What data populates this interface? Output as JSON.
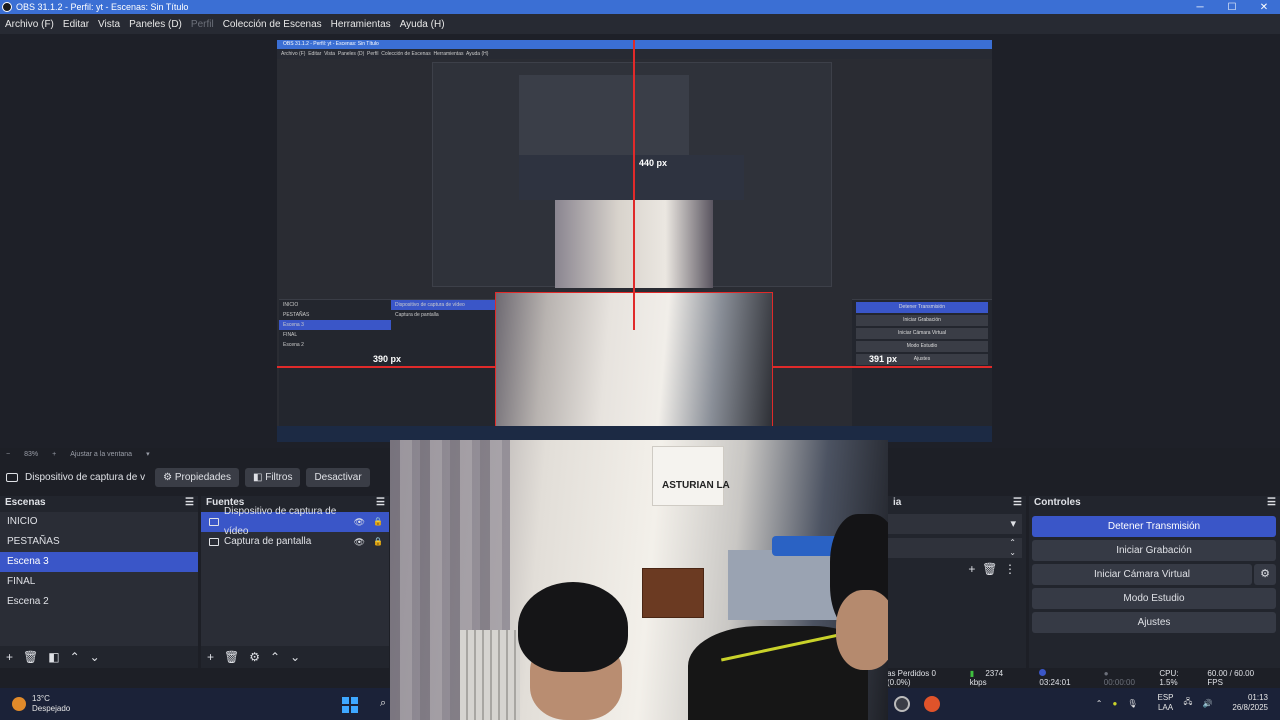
{
  "window": {
    "title": "OBS 31.1.2 - Perfil: yt - Escenas: Sin Título",
    "min": "─",
    "max": "☐",
    "close": "✕"
  },
  "menu": [
    "Archivo (F)",
    "Editar",
    "Vista",
    "Paneles (D)",
    "Perfil",
    "Colección de Escenas",
    "Herramientas",
    "Ayuda (H)"
  ],
  "preview": {
    "inner_title": "OBS 31.1.2 - Perfil: yt - Escenas: Sin Título",
    "px_top": "440 px",
    "px_left": "390 px",
    "px_right": "391 px",
    "mini_scenes": [
      "INICIO",
      "PESTAÑAS",
      "Escena 3",
      "FINAL",
      "Escena 2"
    ],
    "mini_sources": [
      "Dispositivo de captura de vídeo",
      "Captura de pantalla"
    ],
    "mini_controls": [
      "Detener Transmisión",
      "Iniciar Grabación",
      "Iniciar Cámara Virtual",
      "Modo Estudio",
      "Ajustes"
    ],
    "shirt_text": "ASTURIAN LA"
  },
  "zoombar": {
    "minus": "−",
    "zoom": "83%",
    "plus": "+",
    "fit": "Ajustar a la ventana",
    "dropdown": "▾"
  },
  "source_toolbar": {
    "name": "Dispositivo de captura de v",
    "properties": "Propiedades",
    "filters": "Filtros",
    "deactivate": "Desactivar"
  },
  "scenes": {
    "title": "Escenas",
    "items": [
      "INICIO",
      "PESTAÑAS",
      "Escena 3",
      "FINAL",
      "Escena 2"
    ],
    "selected": 2
  },
  "sources": {
    "title": "Fuentes",
    "items": [
      {
        "label": "Dispositivo de captura de vídeo",
        "selected": true
      },
      {
        "label": "Captura de pantalla",
        "selected": false
      }
    ]
  },
  "mixer": {
    "title": "ia"
  },
  "controls": {
    "title": "Controles",
    "stream": "Detener Transmisión",
    "record": "Iniciar Grabación",
    "virtualcam": "Iniciar Cámara Virtual",
    "studio": "Modo Estudio",
    "settings": "Ajustes"
  },
  "status": {
    "dropped": "as Perdidos 0 (0.0%)",
    "bitrate": "2374 kbps",
    "stream_time": "03:24:01",
    "rec_time": "00:00:00",
    "cpu": "CPU: 1.5%",
    "fps": "60.00 / 60.00 FPS"
  },
  "taskbar": {
    "temp": "13°C",
    "weather": "Despejado",
    "lang": "ESP",
    "region": "LAA",
    "time": "01:13",
    "date": "26/8/2025"
  },
  "colors": {
    "accent": "#3a56c8",
    "titlebar": "#3b6fd4",
    "guide": "#e02a2a"
  }
}
